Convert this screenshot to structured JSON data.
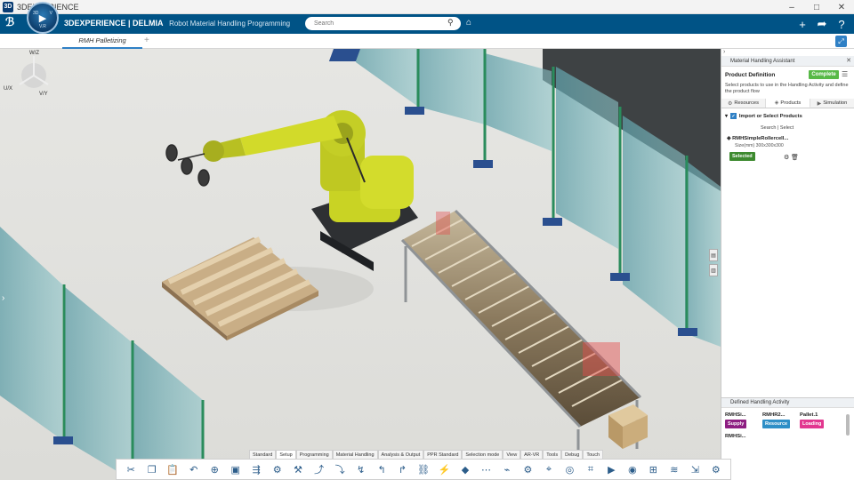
{
  "os": {
    "title": "3DEXPERIENCE",
    "minimize": "–",
    "maximize": "□",
    "close": "✕"
  },
  "app": {
    "brand": "3DEXPERIENCE | DELMIA",
    "subtitle": "Robot Material Handling Programming",
    "compass_3d": "3D",
    "compass_v": "V.R",
    "compass_version": "V.R"
  },
  "search": {
    "placeholder": "Search"
  },
  "tabs": {
    "active": "RMH Palletizing",
    "add": "+"
  },
  "panel": {
    "title": "Material Handling Assistant",
    "product_definition": "Product Definition",
    "status": "Complete",
    "description": "Select products to use in the Handling Activity and define the product flow",
    "tabs": [
      {
        "label": "Resources"
      },
      {
        "label": "Products"
      },
      {
        "label": "Simulation"
      }
    ],
    "import_label": "Import or Select Products",
    "search_select": "Search  |  Select",
    "product": {
      "name": "RMHSimpleRollercell...",
      "size": "Size(mm) 300x300x300",
      "status": "Selected"
    },
    "defined_activity": {
      "title": "Defined Handling Activity",
      "items": [
        {
          "name": "RMHSi...",
          "badge": "Supply",
          "color": "#8e1e82"
        },
        {
          "name": "RMHR2...",
          "badge": "Resource",
          "color": "#2e8fc7"
        },
        {
          "name": "Pallet.1",
          "badge": "Loading",
          "color": "#e2378f"
        }
      ],
      "extra_item": "RMHSi..."
    }
  },
  "section_tabs": [
    "Standard",
    "Setup",
    "Programming",
    "Material Handling",
    "Analysis & Output",
    "PPR Standard",
    "Selection mode",
    "View",
    "AR-VR",
    "Tools",
    "Debug",
    "Touch"
  ],
  "active_section": "Setup",
  "triad": {
    "wz": "W/Z",
    "ux": "U/X",
    "vy": "V/Y"
  }
}
